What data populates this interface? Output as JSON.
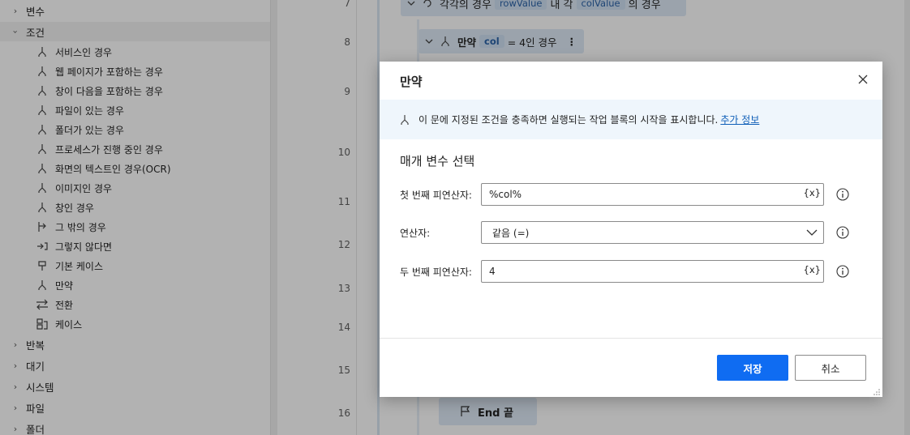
{
  "sidebar": {
    "cat_variables": "변수",
    "cat_conditionals": "조건",
    "items": [
      {
        "label": "서비스인 경우",
        "icon": "branch-icon"
      },
      {
        "label": "웹 페이지가 포함하는 경우",
        "icon": "branch-icon"
      },
      {
        "label": "창이 다음을 포함하는 경우",
        "icon": "branch-icon"
      },
      {
        "label": "파일이 있는 경우",
        "icon": "branch-icon"
      },
      {
        "label": "폴더가 있는 경우",
        "icon": "branch-icon"
      },
      {
        "label": "프로세스가 진행 중인 경우",
        "icon": "branch-icon"
      },
      {
        "label": "화면의 텍스트인 경우(OCR)",
        "icon": "branch-icon"
      },
      {
        "label": "이미지인 경우",
        "icon": "branch-icon"
      },
      {
        "label": "창인 경우",
        "icon": "branch-icon"
      },
      {
        "label": "그 밖의 경우",
        "icon": "else-if-icon"
      },
      {
        "label": "그렇지 않다면",
        "icon": "else-icon"
      },
      {
        "label": "기본 케이스",
        "icon": "default-case-icon"
      },
      {
        "label": "만약",
        "icon": "branch-icon"
      },
      {
        "label": "전환",
        "icon": "switch-icon"
      },
      {
        "label": "케이스",
        "icon": "case-icon"
      }
    ],
    "cat_loops": "반복",
    "cat_wait": "대기",
    "cat_system": "시스템",
    "cat_file": "파일",
    "cat_folder": "폴더"
  },
  "designer": {
    "line_numbers": [
      "7",
      "8",
      "9",
      "10",
      "11",
      "12",
      "13",
      "14",
      "15",
      "16"
    ],
    "top_block": {
      "prefix": "각각의 경우",
      "chip1": "rowValue",
      "middle": "내 각",
      "chip2": "colValue",
      "suffix": "의 경우"
    },
    "if_block": {
      "keyword": "만약",
      "chip": "col",
      "condition": "= 4인 경우",
      "more": "⋮"
    },
    "end_block": {
      "label": "End 끝"
    }
  },
  "dialog": {
    "title": "만약",
    "info_text": "이 문에 지정된 조건을 충족하면 실행되는 작업 블록의 시작을 표시합니다.",
    "info_link": "추가 정보",
    "params_heading": "매개 변수 선택",
    "first_operand_label": "첫 번째 피연산자:",
    "first_operand_value": "%col%",
    "operator_label": "연산자:",
    "operator_value": "같음 (=)",
    "second_operand_label": "두 번째 피연산자:",
    "second_operand_value": "4",
    "var_button": "{x}",
    "save": "저장",
    "cancel": "취소"
  },
  "colors": {
    "accent": "#0f6cf2",
    "link": "#0f5fb8",
    "info_bg": "#eff6fc",
    "block_bg": "#deeaf6"
  }
}
